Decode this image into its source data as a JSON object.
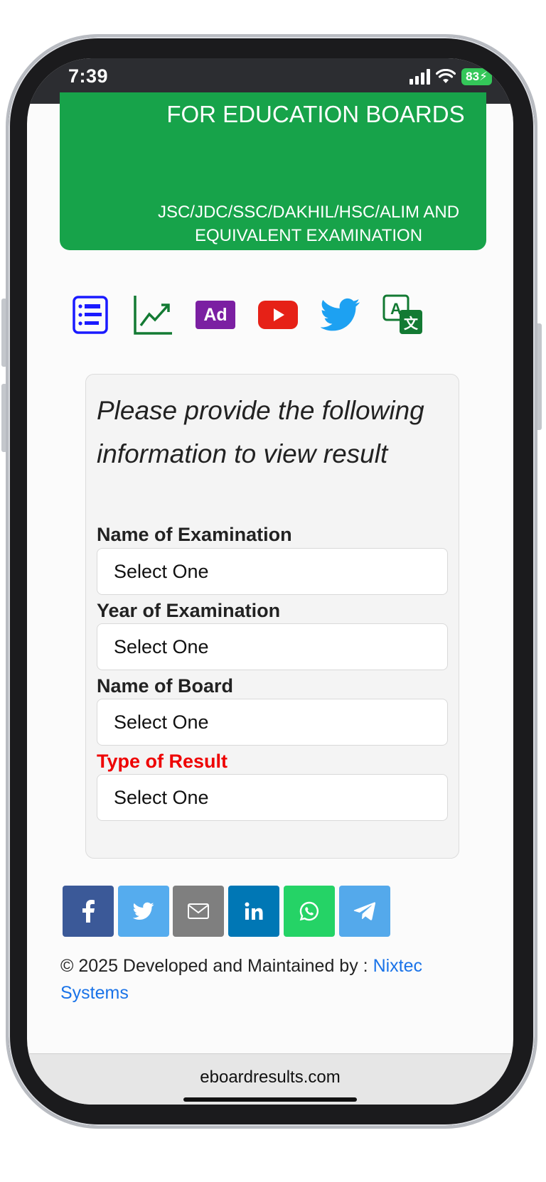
{
  "status": {
    "time": "7:39",
    "battery": "83"
  },
  "banner": {
    "title": "FOR EDUCATION BOARDS",
    "subtitle": "JSC/JDC/SSC/DAKHIL/HSC/ALIM AND EQUIVALENT EXAMINATION"
  },
  "icons": [
    {
      "name": "result-list-icon",
      "color": "#1a1aff"
    },
    {
      "name": "statistics-chart-icon",
      "color": "#137a33"
    },
    {
      "name": "ad-icon",
      "color": "#7b1fa2",
      "text": "Ad"
    },
    {
      "name": "youtube-icon",
      "color": "#e62117"
    },
    {
      "name": "twitter-icon",
      "color": "#1da1f2"
    },
    {
      "name": "translate-icon",
      "color": "#137a33"
    }
  ],
  "form": {
    "heading": "Please provide the following information to view result",
    "fields": [
      {
        "label": "Name of Examination",
        "value": "Select One"
      },
      {
        "label": "Year of Examination",
        "value": "Select One"
      },
      {
        "label": "Name of Board",
        "value": "Select One"
      },
      {
        "label": "Type of Result",
        "value": "Select One",
        "label_color": "#ee0000"
      }
    ]
  },
  "share": [
    {
      "name": "facebook-share-button",
      "color": "#3b5998"
    },
    {
      "name": "twitter-share-button",
      "color": "#55acee"
    },
    {
      "name": "email-share-button",
      "color": "#7f7f7f"
    },
    {
      "name": "linkedin-share-button",
      "color": "#0077b5"
    },
    {
      "name": "whatsapp-share-button",
      "color": "#25d366"
    },
    {
      "name": "telegram-share-button",
      "color": "#54a9eb"
    }
  ],
  "footer": {
    "text": "© 2025 Developed and Maintained by : ",
    "link": "Nixtec Systems"
  },
  "browser": {
    "url": "eboardresults.com"
  }
}
